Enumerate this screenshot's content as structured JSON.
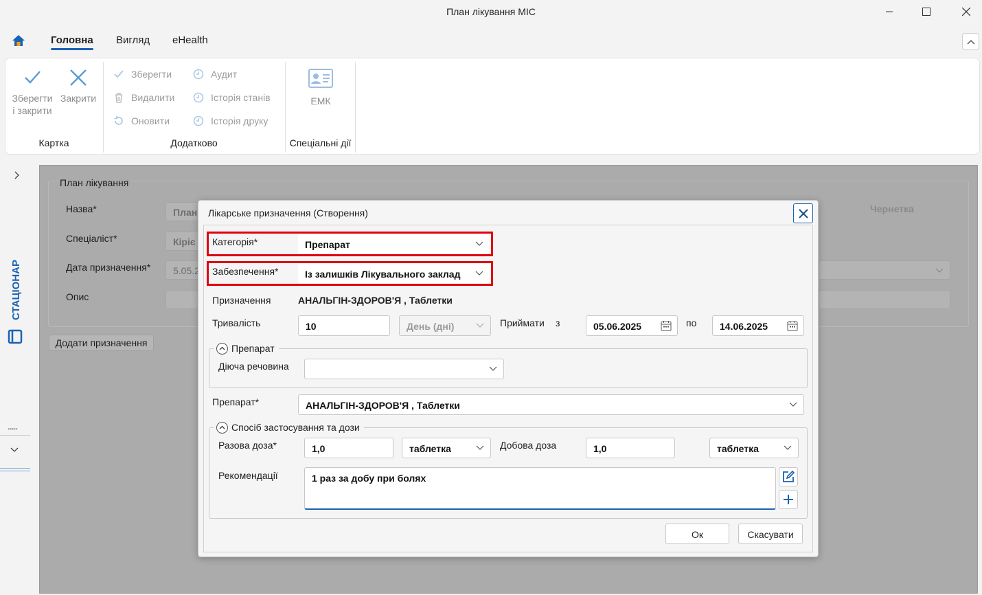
{
  "window": {
    "title": "План лікування МІС"
  },
  "ribbon": {
    "tabs": [
      "Головна",
      "Вигляд",
      "eHealth"
    ],
    "card_group": {
      "label": "Картка",
      "save_close": [
        "Зберегти",
        "і закрити"
      ],
      "close": "Закрити"
    },
    "extra_group": {
      "label": "Додатково",
      "items": [
        "Зберегти",
        "Видалити",
        "Оновити",
        "Аудит",
        "Історія станів",
        "Історія друку"
      ]
    },
    "special_group": {
      "label": "Спеціальні дії",
      "emk": "ЕМК"
    }
  },
  "sidebar": {
    "label": "СТАЦІОНАР",
    "dots": "....."
  },
  "plan_form": {
    "title": "План лікування",
    "name_label": "Назва*",
    "name_value": "План",
    "specialist_label": "Спеціаліст*",
    "specialist_value": "Кіріє",
    "date_label": "Дата призначення*",
    "date_value": "5.05.2",
    "description_label": "Опис",
    "status": "Чернетка",
    "add_button": "Додати призначення"
  },
  "dialog": {
    "title": "Лікарське призначення (Створення)",
    "category_label": "Категорія*",
    "category_value": "Препарат",
    "supply_label": "Забезпечення*",
    "supply_value": "Із залишків Лікувального заклад",
    "prescription_label": "Призначення",
    "prescription_value": "АНАЛЬГІН-ЗДОРОВ'Я , Таблетки",
    "duration_label": "Тривалість",
    "duration_value": "10",
    "duration_unit": "День (дні)",
    "take_label": "Приймати",
    "from_label": "з",
    "from_date": "05.06.2025",
    "to_label": "по",
    "to_date": "14.06.2025",
    "drug_group": {
      "title": "Препарат",
      "substance_label": "Діюча речовина",
      "substance_value": ""
    },
    "drug_label": "Препарат*",
    "drug_value": "АНАЛЬГІН-ЗДОРОВ'Я , Таблетки",
    "dose_group": {
      "title": "Спосіб застосування та дози",
      "single_label": "Разова доза*",
      "single_value": "1,0",
      "single_unit": "таблетка",
      "daily_label": "Добова доза",
      "daily_value": "1,0",
      "daily_unit": "таблетка",
      "rec_label": "Рекомендації",
      "rec_value": "1 раз за добу при болях"
    },
    "ok": "Ок",
    "cancel": "Скасувати"
  },
  "colors": {
    "accent": "#1a62b3",
    "highlight": "#e0000f"
  }
}
